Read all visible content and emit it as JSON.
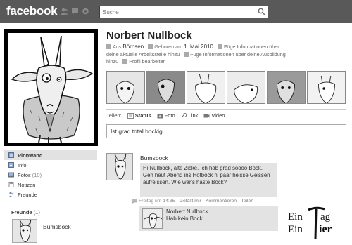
{
  "topbar": {
    "logo": "facebook",
    "search_placeholder": "Suche",
    "icons": [
      "friend-requests-icon",
      "messages-icon",
      "notifications-icon",
      "search-icon"
    ]
  },
  "nav": {
    "items": [
      {
        "label": "Pinnwand",
        "count": "",
        "icon": "wall-icon"
      },
      {
        "label": "Info",
        "count": "",
        "icon": "info-icon"
      },
      {
        "label": "Fotos",
        "count": "(10)",
        "icon": "photos-icon"
      },
      {
        "label": "Notizen",
        "count": "",
        "icon": "notes-icon"
      },
      {
        "label": "Freunde",
        "count": "",
        "icon": "friends-icon"
      }
    ],
    "friends_heading": "Freunde",
    "friends_count": "(1)",
    "friend_name": "Bumsbock"
  },
  "profile": {
    "name": "Norbert Nullbock",
    "from_prefix": "Aus",
    "from_value": "Börnsen",
    "born_prefix": "Geboren am",
    "born_value": "1. Mai 2010",
    "add_work": "Füge Informationen über",
    "add_work_2": "deine aktuelle Arbeitsstelle hinzu",
    "add_edu": "Füge Informationen über deine Ausbildung",
    "add_edu_2": "hinzu",
    "edit_profile": "Profil bearbeiten"
  },
  "share": {
    "label": "Teilen:",
    "options": [
      {
        "label": "Status",
        "icon": "status-icon"
      },
      {
        "label": "Foto",
        "icon": "camera-icon"
      },
      {
        "label": "Link",
        "icon": "link-icon"
      },
      {
        "label": "Video",
        "icon": "video-icon"
      }
    ],
    "status_value": "Ist grad total bockig."
  },
  "post": {
    "author": "Bumsbock",
    "message": "Hi Nullbock, alte Zicke. Ich hab grad soooo Bock. Geh heut Abend ins Hotbock n' paar heisse Geissen aufreissen. Wie wär's haste Bock?",
    "time": "Freitag um 14:35",
    "sep": "·",
    "like": "Gefällt mir",
    "comments": "Kommentieren",
    "share": "Teilen"
  },
  "comment": {
    "author": "Norbert Nullbock",
    "text": "Hab kein Bock."
  },
  "signature": {
    "text": "Ein Tag Ein Tier"
  },
  "colors": {
    "topbar": "#595959",
    "active_nav": "#e2e2e2",
    "bubble": "#e3e3e3"
  }
}
